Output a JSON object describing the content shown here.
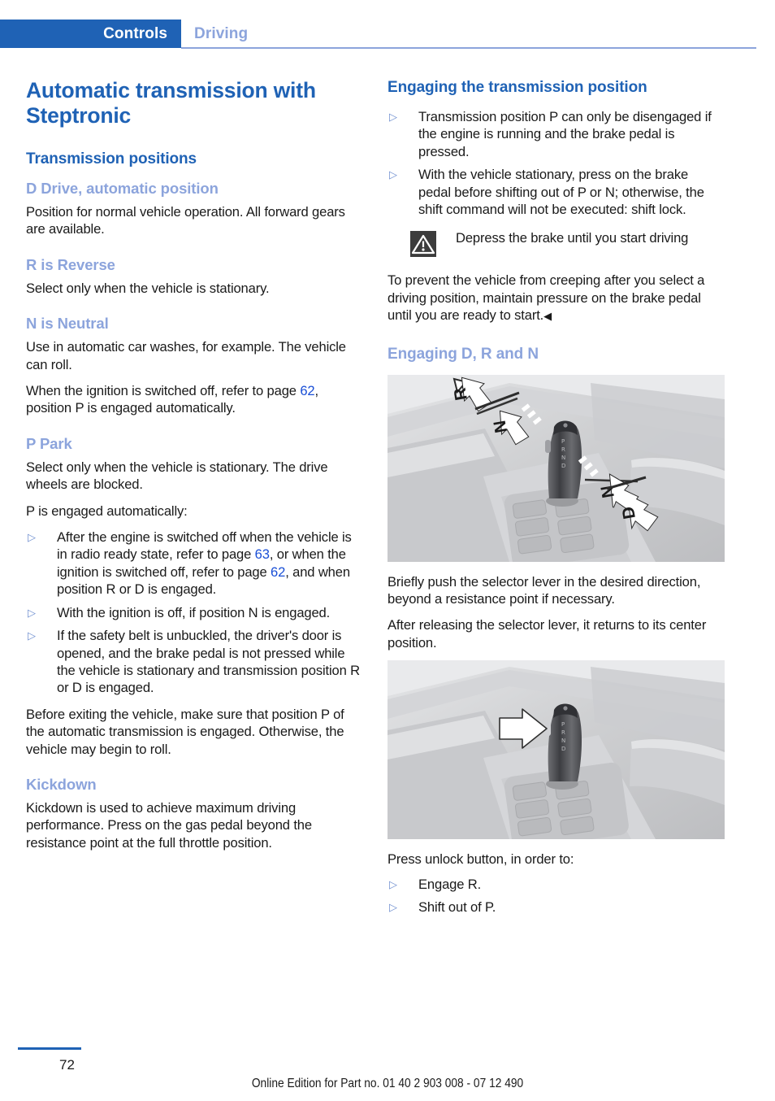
{
  "header": {
    "active_tab": "Controls",
    "inactive_tab": "Driving",
    "accent_color": "#1f62b5",
    "light_accent_color": "#8ca4dc"
  },
  "left_column": {
    "title": "Automatic transmission with Steptronic",
    "section_heading": "Transmission positions",
    "drive": {
      "heading": "D Drive, automatic position",
      "text": "Position for normal vehicle operation. All forward gears are available."
    },
    "reverse": {
      "heading": "R is Reverse",
      "text": "Select only when the vehicle is stationary."
    },
    "neutral": {
      "heading": "N is Neutral",
      "text1": "Use in automatic car washes, for example. The vehicle can roll.",
      "text2_before": "When the ignition is switched off, refer to page ",
      "text2_ref": "62",
      "text2_after": ", position P is engaged automatically."
    },
    "park": {
      "heading": "P Park",
      "text1": "Select only when the vehicle is stationary. The drive wheels are blocked.",
      "text2": "P is engaged automatically:",
      "bullet1_a": "After the engine is switched off when the vehicle is in radio ready state, refer to page ",
      "bullet1_ref1": "63",
      "bullet1_b": ", or when the ignition is switched off, refer to page ",
      "bullet1_ref2": "62",
      "bullet1_c": ", and when position R or D is engaged.",
      "bullet2": "With the ignition is off, if position N is engaged.",
      "bullet3": "If the safety belt is unbuckled, the driver's door is opened, and the brake pedal is not pressed while the vehicle is stationary and transmission position R or D is engaged.",
      "closing": "Before exiting the vehicle, make sure that position P of the automatic transmission is engaged. Otherwise, the vehicle may begin to roll."
    },
    "kickdown": {
      "heading": "Kickdown",
      "text": "Kickdown is used to achieve maximum driving performance. Press on the gas pedal beyond the resistance point at the full throttle position."
    }
  },
  "right_column": {
    "engaging_position": {
      "heading": "Engaging the transmission position",
      "bullet1": "Transmission position P can only be disengaged if the engine is running and the brake pedal is pressed.",
      "bullet2": "With the vehicle stationary, press on the brake pedal before shifting out of P or N; otherwise, the shift command will not be executed: shift lock.",
      "warning_text": "Depress the brake until you start driving",
      "warning_body": "To prevent the vehicle from creeping after you select a driving position, maintain pressure on the brake pedal until you are ready to start.",
      "warning_end_marker": "◀"
    },
    "engaging_drn": {
      "heading": "Engaging D, R and N",
      "figure1_labels": [
        "R",
        "N",
        "N",
        "D"
      ],
      "text1": "Briefly push the selector lever in the desired direction, beyond a resistance point if necessary.",
      "text2": "After releasing the selector lever, it returns to its center position.",
      "text3": "Press unlock button, in order to:",
      "bullet1": "Engage R.",
      "bullet2": "Shift out of P."
    }
  },
  "footer": {
    "page_number": "72",
    "edition_text": "Online Edition for Part no. 01 40 2 903 008 - 07 12 490"
  },
  "bullet_glyph": "▷"
}
